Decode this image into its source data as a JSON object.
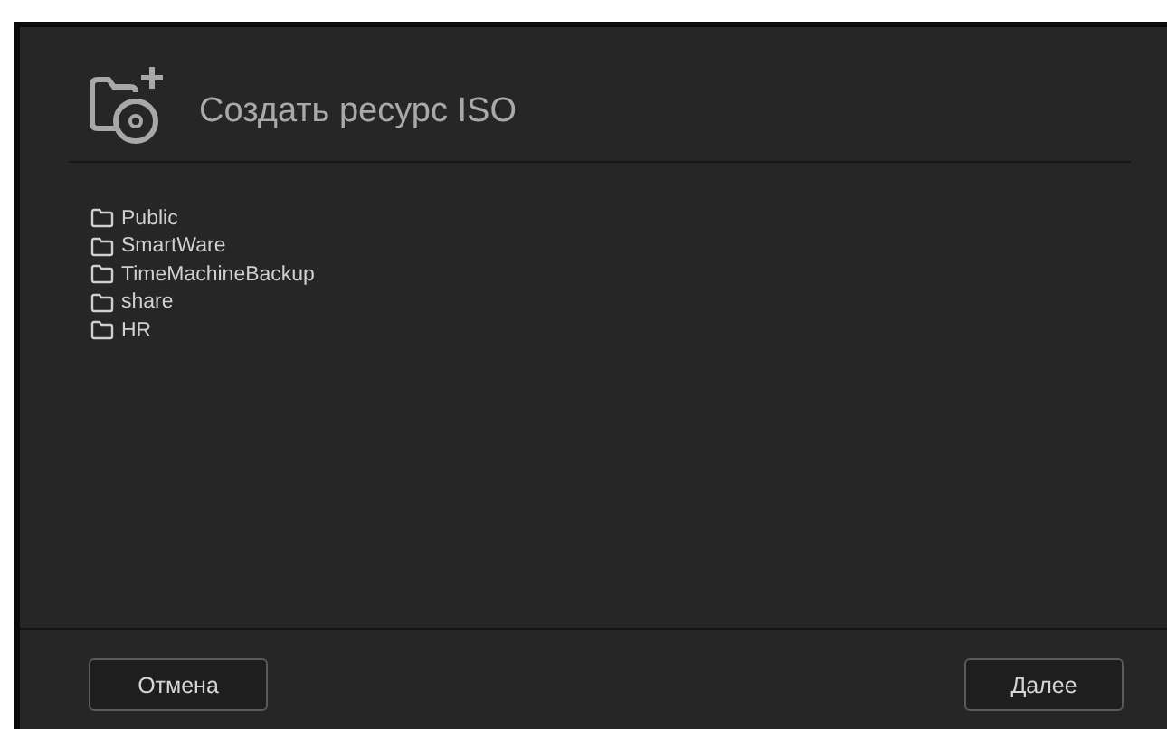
{
  "dialog": {
    "title": "Создать ресурс ISO",
    "folders": [
      {
        "name": "Public"
      },
      {
        "name": "SmartWare"
      },
      {
        "name": "TimeMachineBackup"
      },
      {
        "name": "share"
      },
      {
        "name": "HR"
      }
    ],
    "buttons": [
      {
        "label": "Отмена",
        "kind": "cancel"
      },
      {
        "label": "Далее",
        "kind": "next"
      }
    ]
  }
}
